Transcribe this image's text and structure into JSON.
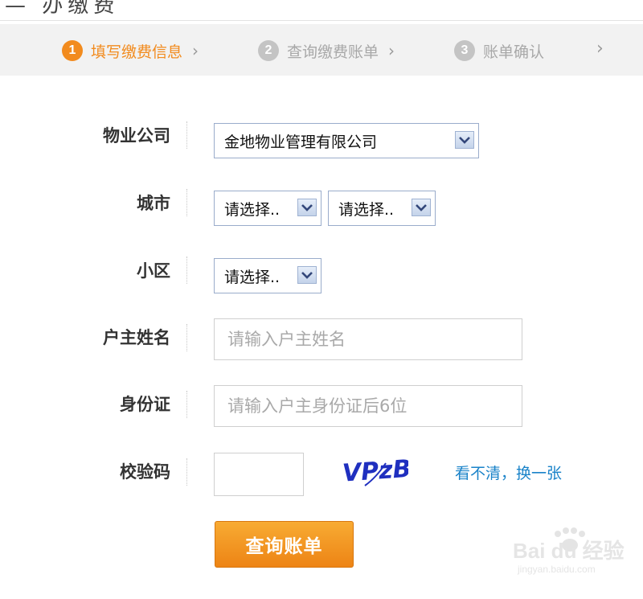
{
  "header": {
    "title_fragment": "—  办缴费"
  },
  "steps": [
    {
      "number": "1",
      "label": "填写缴费信息",
      "state": "active"
    },
    {
      "number": "2",
      "label": "查询缴费账单",
      "state": "inactive"
    },
    {
      "number": "3",
      "label": "账单确认",
      "state": "inactive"
    }
  ],
  "form": {
    "property_company": {
      "label": "物业公司",
      "value": "金地物业管理有限公司"
    },
    "city": {
      "label": "城市",
      "province_value": "请选择..",
      "city_value": "请选择.."
    },
    "community": {
      "label": "小区",
      "value": "请选择.."
    },
    "owner_name": {
      "label": "户主姓名",
      "placeholder": "请输入户主姓名"
    },
    "id_card": {
      "label": "身份证",
      "placeholder": "请输入户主身份证后6位"
    },
    "captcha": {
      "label": "校验码",
      "value": "",
      "image_text": "VPzB",
      "refresh_link": "看不清，换一张"
    },
    "submit_label": "查询账单"
  },
  "watermark": {
    "text": "Bai du 经验",
    "url_text": "jingyan.baidu.com"
  },
  "colors": {
    "accent": "#f28b1e",
    "link": "#1a83c9",
    "inactive": "#c4c4c4",
    "select_border": "#9aaccb"
  },
  "icons": [
    "chevron-right-icon",
    "dropdown-arrow-icon"
  ]
}
